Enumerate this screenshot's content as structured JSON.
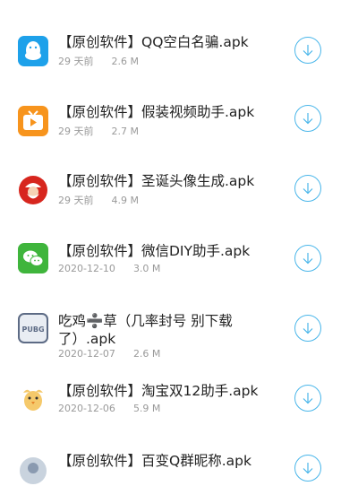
{
  "items": [
    {
      "title": "【原创软件】QQ空白名骗.apk",
      "date": "29 天前",
      "size": "2.6 M",
      "icon": "qq-penguin-icon"
    },
    {
      "title": "【原创软件】假装视频助手.apk",
      "date": "29 天前",
      "size": "2.7 M",
      "icon": "video-tv-icon"
    },
    {
      "title": "【原创软件】圣诞头像生成.apk",
      "date": "29 天前",
      "size": "4.9 M",
      "icon": "santa-icon"
    },
    {
      "title": "【原创软件】微信DIY助手.apk",
      "date": "2020-12-10",
      "size": "3.0 M",
      "icon": "wechat-icon"
    },
    {
      "title": "吃鸡➗草（几率封号 别下载了）.apk",
      "date": "2020-12-07",
      "size": "2.6 M",
      "icon": "pubg-icon"
    },
    {
      "title": "【原创软件】淘宝双12助手.apk",
      "date": "2020-12-06",
      "size": "5.9 M",
      "icon": "chick-mascot-icon"
    },
    {
      "title": "【原创软件】百变Q群昵称.apk",
      "date": "",
      "size": "",
      "icon": "avatar-icon"
    }
  ],
  "colors": {
    "accent": "#49b6ea",
    "meta_text": "#9a9a9a",
    "title_text": "#222222"
  }
}
